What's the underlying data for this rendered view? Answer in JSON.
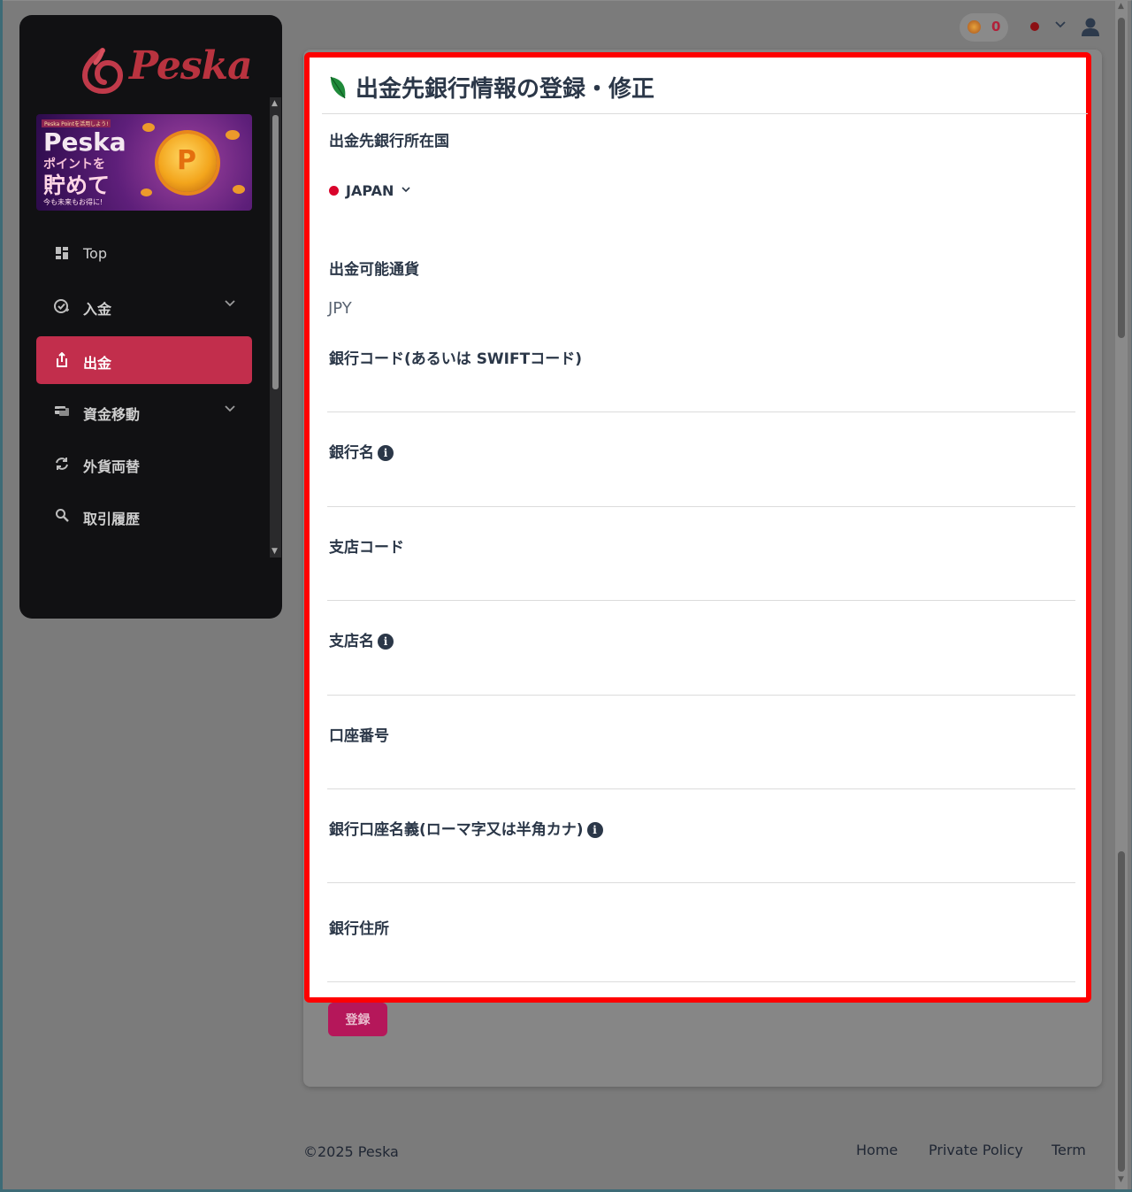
{
  "brand": {
    "logo_text": "Peska",
    "banner": {
      "small": "Peska Pointを活用しよう!",
      "line1": "Peska",
      "line2": "ポイントを",
      "line3": "貯めて",
      "line4": "今も未来もお得に!",
      "coin_letter": "P"
    }
  },
  "sidebar": {
    "items": [
      {
        "label": "Top",
        "icon": "dashboard-icon",
        "has_submenu": false,
        "active": false
      },
      {
        "label": "入金",
        "icon": "deposit-check-icon",
        "has_submenu": true,
        "active": false
      },
      {
        "label": "出金",
        "icon": "withdraw-share-icon",
        "has_submenu": false,
        "active": true
      },
      {
        "label": "資金移動",
        "icon": "transfer-icon",
        "has_submenu": true,
        "active": false
      },
      {
        "label": "外貨両替",
        "icon": "exchange-icon",
        "has_submenu": false,
        "active": false
      },
      {
        "label": "取引履歴",
        "icon": "search-icon",
        "has_submenu": false,
        "active": false
      }
    ]
  },
  "header": {
    "points": "0",
    "language_flag": "japan-flag-dot",
    "user_icon": "user-icon"
  },
  "modal": {
    "title": "出金先銀行情報の登録・修正",
    "country": {
      "label": "出金先銀行所在国",
      "selected": "JAPAN"
    },
    "currency": {
      "label": "出金可能通貨",
      "value": "JPY"
    },
    "fields": [
      {
        "label": "銀行コード(あるいは SWIFTコード)",
        "info": false,
        "value": ""
      },
      {
        "label": "銀行名",
        "info": true,
        "value": ""
      },
      {
        "label": "支店コード",
        "info": false,
        "value": ""
      },
      {
        "label": "支店名",
        "info": true,
        "value": ""
      },
      {
        "label": "口座番号",
        "info": false,
        "value": ""
      },
      {
        "label": "銀行口座名義(ローマ字又は半角カナ)",
        "info": true,
        "value": ""
      },
      {
        "label": "銀行住所",
        "info": false,
        "value": ""
      }
    ]
  },
  "submit_label": "登録",
  "footer": {
    "copyright": "©2025 Peska",
    "links": [
      "Home",
      "Private Policy",
      "Term"
    ]
  },
  "colors": {
    "accent": "#c22e4c",
    "modal_border": "#ff0000",
    "sidebar_bg": "#111113",
    "text_dark": "#2b3748"
  }
}
